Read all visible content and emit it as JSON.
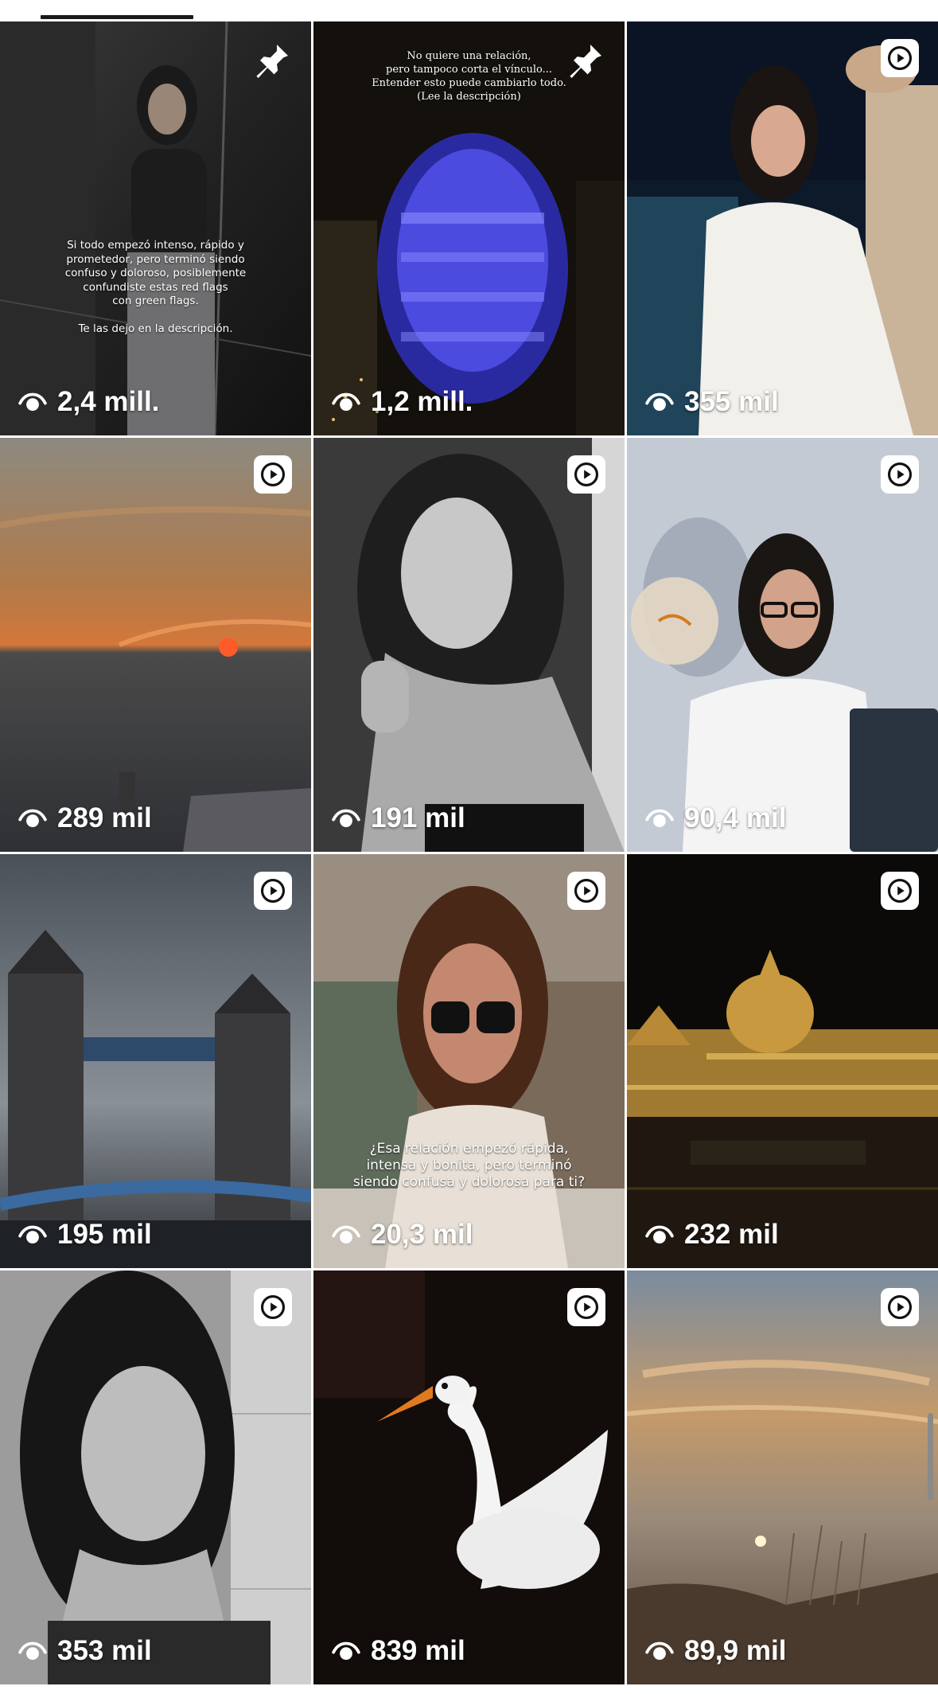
{
  "tiles": [
    {
      "views": "2,4 mill.",
      "icon": "pin-icon",
      "overlay": "Si todo empezó intenso, rápido y\nprometedor, pero terminó siendo\nconfuso y doloroso, posiblemente\nconfundiste estas red flags\ncon green flags.\n\nTe las dejo en la descripción."
    },
    {
      "views": "1,2 mill.",
      "icon": "pin-icon",
      "overlay": "No quiere una relación,\npero tampoco corta el vínculo...\nEntender esto puede cambiarlo todo.\n(Lee la descripción)"
    },
    {
      "views": "355 mil",
      "icon": "play-icon",
      "overlay": ""
    },
    {
      "views": "289 mil",
      "icon": "play-icon",
      "overlay": ""
    },
    {
      "views": "191 mil",
      "icon": "play-icon",
      "overlay": ""
    },
    {
      "views": "90,4 mil",
      "icon": "play-icon",
      "overlay": ""
    },
    {
      "views": "195 mil",
      "icon": "play-icon",
      "overlay": ""
    },
    {
      "views": "20,3 mil",
      "icon": "play-icon",
      "overlay": "¿Esa relación empezó rápida,\nintensa y bonita, pero terminó\nsiendo confusa y dolorosa para ti?"
    },
    {
      "views": "232 mil",
      "icon": "play-icon",
      "overlay": ""
    },
    {
      "views": "353 mil",
      "icon": "play-icon",
      "overlay": ""
    },
    {
      "views": "839 mil",
      "icon": "play-icon",
      "overlay": ""
    },
    {
      "views": "89,9 mil",
      "icon": "play-icon",
      "overlay": ""
    }
  ],
  "colors": {
    "indicator": "#1a1a1a",
    "badge": "#ffffff",
    "text": "#ffffff"
  }
}
